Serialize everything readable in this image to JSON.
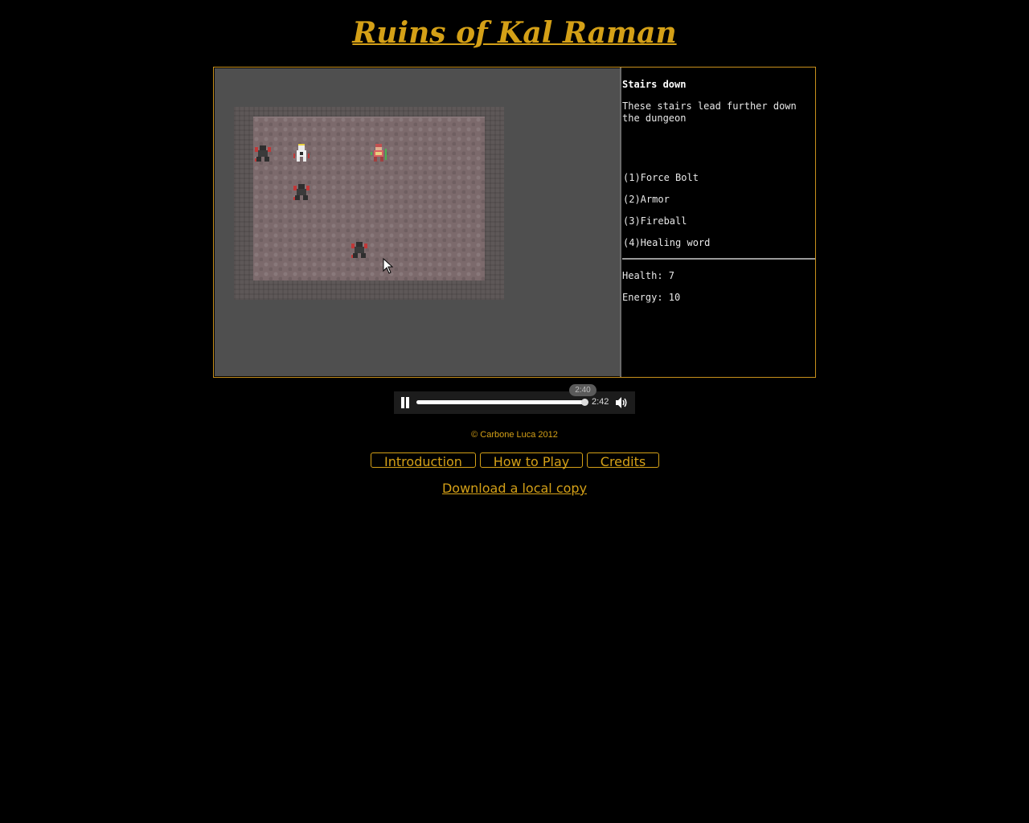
{
  "title": "Ruins of Kal Raman",
  "info": {
    "heading": "Stairs down",
    "description": "These stairs lead further down the dungeon",
    "spells": [
      "(1)Force Bolt",
      "(2)Armor",
      "(3)Fireball",
      "(4)Healing word"
    ],
    "health_label": "Health: 7",
    "energy_label": "Energy: 10"
  },
  "player": {
    "hover_time": "2:40",
    "duration": "2:42",
    "progress": 0.98
  },
  "footer": {
    "copyright": "© Carbone Luca 2012",
    "buttons": [
      "Introduction",
      "How to Play",
      "Credits"
    ],
    "download": "Download a local copy"
  },
  "colors": {
    "accent": "#d4a017",
    "background": "#000000",
    "canvas": "#4f4f4f"
  },
  "icons": [
    "pause-icon",
    "volume-icon",
    "mouse-cursor-icon"
  ]
}
